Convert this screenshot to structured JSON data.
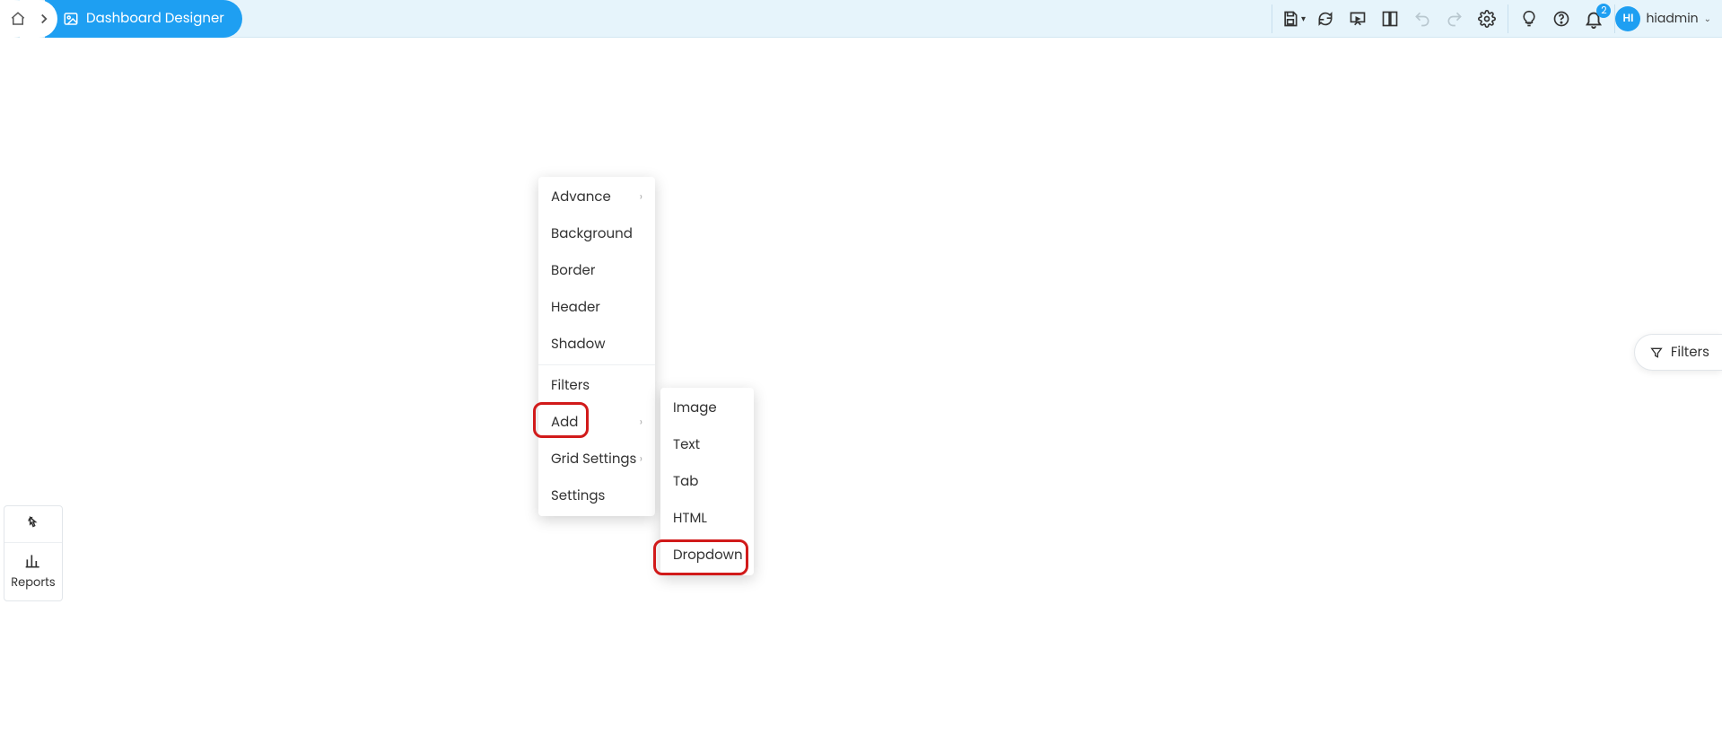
{
  "topbar": {
    "title": "Dashboard Designer"
  },
  "user": {
    "initials": "HI",
    "name": "hiadmin"
  },
  "notifications": {
    "count": "2"
  },
  "filters_button_label": "Filters",
  "left_panel": {
    "reports_label": "Reports"
  },
  "context_menu": {
    "items": [
      {
        "label": "Advance",
        "has_sub": true,
        "highlight": false
      },
      {
        "label": "Background",
        "has_sub": false,
        "highlight": false
      },
      {
        "label": "Border",
        "has_sub": false,
        "highlight": false
      },
      {
        "label": "Header",
        "has_sub": false,
        "highlight": false
      },
      {
        "label": "Shadow",
        "has_sub": false,
        "highlight": false
      }
    ],
    "items_group2": [
      {
        "label": "Filters",
        "has_sub": false,
        "highlight": false
      },
      {
        "label": "Add",
        "has_sub": true,
        "highlight": true
      },
      {
        "label": "Grid Settings",
        "has_sub": true,
        "highlight": false
      },
      {
        "label": "Settings",
        "has_sub": false,
        "highlight": false
      }
    ]
  },
  "submenu": {
    "items": [
      {
        "label": "Image",
        "highlight": false
      },
      {
        "label": "Text",
        "highlight": false
      },
      {
        "label": "Tab",
        "highlight": false
      },
      {
        "label": "HTML",
        "highlight": false
      },
      {
        "label": "Dropdown",
        "highlight": true
      }
    ]
  }
}
